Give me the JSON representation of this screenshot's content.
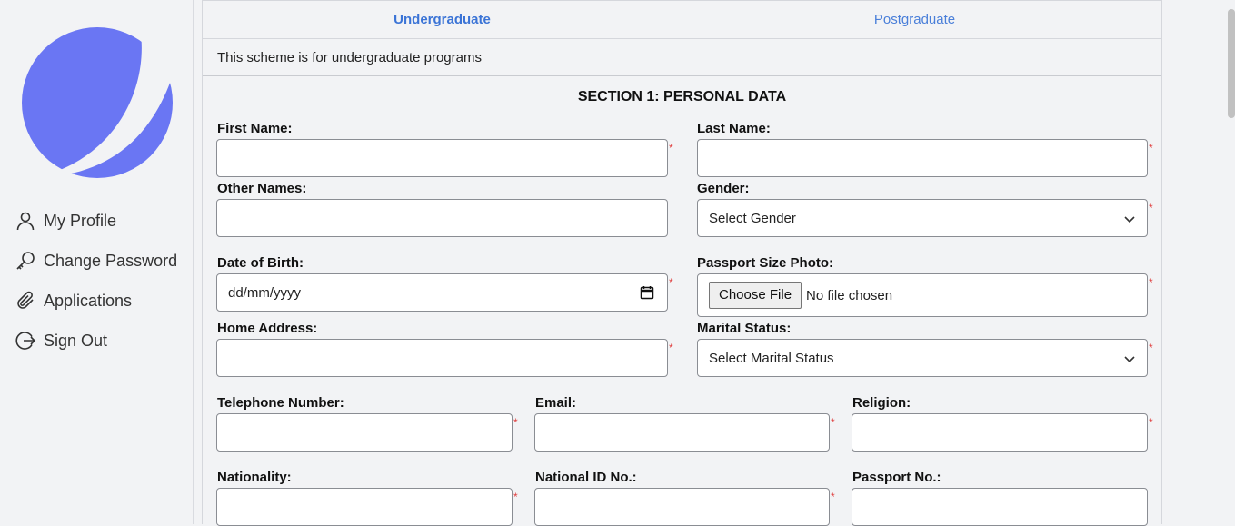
{
  "sidebar": {
    "logo": "app-logo",
    "items": [
      {
        "label": "My Profile",
        "icon": "user-icon"
      },
      {
        "label": "Change Password",
        "icon": "key-icon"
      },
      {
        "label": "Applications",
        "icon": "paperclip-icon"
      },
      {
        "label": "Sign Out",
        "icon": "sign-out-icon"
      }
    ]
  },
  "tabs": [
    {
      "label": "Undergraduate",
      "active": true
    },
    {
      "label": "Postgraduate",
      "active": false
    }
  ],
  "note": "This scheme is for undergraduate programs",
  "section": {
    "title": "SECTION 1: PERSONAL DATA"
  },
  "fields": {
    "first_name": {
      "label": "First Name:",
      "value": ""
    },
    "last_name": {
      "label": "Last Name:",
      "value": ""
    },
    "other_names": {
      "label": "Other Names:",
      "value": ""
    },
    "gender": {
      "label": "Gender:",
      "selected": "Select Gender"
    },
    "dob": {
      "label": "Date of Birth:",
      "placeholder": "dd/mm/yyyy"
    },
    "photo": {
      "label": "Passport Size Photo:",
      "button": "Choose File",
      "status": "No file chosen"
    },
    "home_address": {
      "label": "Home Address:",
      "value": ""
    },
    "marital_status": {
      "label": "Marital Status:",
      "selected": "Select Marital Status"
    },
    "telephone": {
      "label": "Telephone Number:",
      "value": ""
    },
    "email": {
      "label": "Email:",
      "value": ""
    },
    "religion": {
      "label": "Religion:",
      "value": ""
    },
    "nationality": {
      "label": "Nationality:",
      "value": ""
    },
    "national_id": {
      "label": "National ID No.:",
      "value": ""
    },
    "passport_no": {
      "label": "Passport No.:",
      "value": ""
    }
  },
  "required_marker": "*",
  "colors": {
    "accent": "#6a76f3",
    "link": "#3b74d6",
    "required": "#e04040"
  }
}
